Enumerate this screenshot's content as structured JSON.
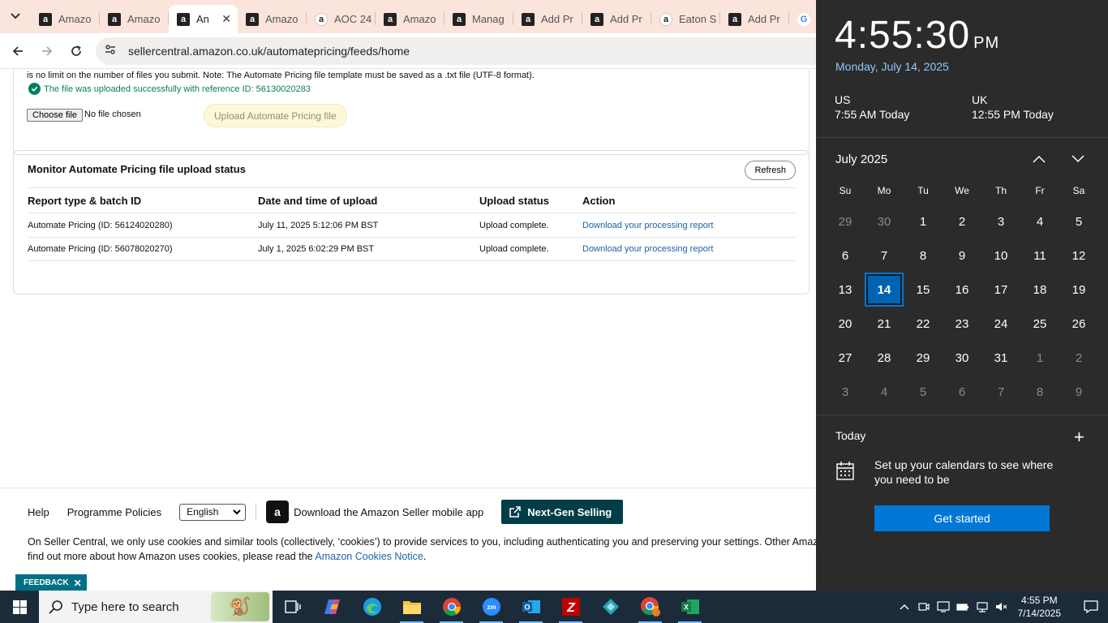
{
  "browser": {
    "tabs": [
      {
        "label": "Amazo",
        "icon": "amazon-favicon"
      },
      {
        "label": "Amazo",
        "icon": "amazon-favicon"
      },
      {
        "label": "An",
        "icon": "amazon-favicon",
        "active": true
      },
      {
        "label": "Amazo",
        "icon": "amazon-favicon"
      },
      {
        "label": "AOC 24",
        "icon": "amazon-smile-favicon"
      },
      {
        "label": "Amazo",
        "icon": "amazon-favicon"
      },
      {
        "label": "Manag",
        "icon": "amazon-favicon"
      },
      {
        "label": "Add Pr",
        "icon": "amazon-favicon"
      },
      {
        "label": "Add Pr",
        "icon": "amazon-favicon"
      },
      {
        "label": "Eaton S",
        "icon": "amazon-smile-favicon"
      },
      {
        "label": "Add Pr",
        "icon": "amazon-favicon"
      },
      {
        "label": "",
        "icon": "google-favicon"
      }
    ],
    "url": "sellercentral.amazon.co.uk/automatepricing/feeds/home"
  },
  "upload_section": {
    "note": "is no limit on the number of files you submit. Note: The Automate Pricing file template must be saved as a .txt file (UTF-8 format).",
    "success_message": "The file was uploaded successfully with reference ID: 56130020283",
    "choose_file_label": "Choose file",
    "no_file_text": "No file chosen",
    "upload_button": "Upload Automate Pricing file"
  },
  "monitor": {
    "title": "Monitor Automate Pricing file upload status",
    "refresh_label": "Refresh",
    "columns": [
      "Report type & batch ID",
      "Date and time of upload",
      "Upload status",
      "Action"
    ],
    "rows": [
      {
        "report": "Automate Pricing (ID: 56124020280)",
        "date": "July 11, 2025 5:12:06 PM BST",
        "status": "Upload complete.",
        "action": "Download your processing report"
      },
      {
        "report": "Automate Pricing (ID: 56078020270)",
        "date": "July 1, 2025 6:02:29 PM BST",
        "status": "Upload complete.",
        "action": "Download your processing report"
      }
    ]
  },
  "footer": {
    "help": "Help",
    "policies": "Programme Policies",
    "language": "English",
    "app_link": "Download the Amazon Seller mobile app",
    "next_gen": "Next-Gen Selling",
    "cookie_line1": "On Seller Central, we only use cookies and similar tools (collectively, ‘cookies’) to provide services to you, including authenticating you and preserving your settings. Other Amazon sites",
    "cookie_line2_prefix": "find out more about how Amazon uses cookies, please read the",
    "cookie_link": "Amazon Cookies Notice",
    "cookie_line2_suffix": ".",
    "feedback": "FEEDBACK"
  },
  "flyout": {
    "time": "4:55:30",
    "ampm": "PM",
    "date": "Monday, July 14, 2025",
    "zones": [
      {
        "name": "US",
        "time": "7:55 AM Today"
      },
      {
        "name": "UK",
        "time": "12:55 PM Today"
      }
    ],
    "month": "July 2025",
    "weekdays": [
      "Su",
      "Mo",
      "Tu",
      "We",
      "Th",
      "Fr",
      "Sa"
    ],
    "days": [
      {
        "d": "29",
        "o": true
      },
      {
        "d": "30",
        "o": true
      },
      {
        "d": "1"
      },
      {
        "d": "2"
      },
      {
        "d": "3"
      },
      {
        "d": "4"
      },
      {
        "d": "5"
      },
      {
        "d": "6"
      },
      {
        "d": "7"
      },
      {
        "d": "8"
      },
      {
        "d": "9"
      },
      {
        "d": "10"
      },
      {
        "d": "11"
      },
      {
        "d": "12"
      },
      {
        "d": "13"
      },
      {
        "d": "14",
        "t": true
      },
      {
        "d": "15"
      },
      {
        "d": "16"
      },
      {
        "d": "17"
      },
      {
        "d": "18"
      },
      {
        "d": "19"
      },
      {
        "d": "20"
      },
      {
        "d": "21"
      },
      {
        "d": "22"
      },
      {
        "d": "23"
      },
      {
        "d": "24"
      },
      {
        "d": "25"
      },
      {
        "d": "26"
      },
      {
        "d": "27"
      },
      {
        "d": "28"
      },
      {
        "d": "29"
      },
      {
        "d": "30"
      },
      {
        "d": "31"
      },
      {
        "d": "1",
        "o": true
      },
      {
        "d": "2",
        "o": true
      },
      {
        "d": "3",
        "o": true
      },
      {
        "d": "4",
        "o": true
      },
      {
        "d": "5",
        "o": true
      },
      {
        "d": "6",
        "o": true
      },
      {
        "d": "7",
        "o": true
      },
      {
        "d": "8",
        "o": true
      },
      {
        "d": "9",
        "o": true
      }
    ],
    "today_label": "Today",
    "setup_text": "Set up your calendars to see where you need to be",
    "get_started": "Get started"
  },
  "taskbar": {
    "search_placeholder": "Type here to search",
    "time": "4:55 PM",
    "date": "7/14/2025",
    "apps": [
      "task-view-icon",
      "copilot-icon",
      "edge-icon",
      "file-explorer-icon",
      "chrome-icon",
      "zoom-icon",
      "outlook-icon",
      "filezilla-icon",
      "app-icon",
      "chrome-profile-icon",
      "excel-icon"
    ]
  },
  "colors": {
    "tab_strip": "#fbe4dc",
    "success": "#067d62",
    "link": "#2162a1",
    "next_gen_bg": "#003d47",
    "flyout_bg": "#2b2b2b",
    "accent_blue": "#0078d7",
    "taskbar": "#1c2b3a"
  }
}
